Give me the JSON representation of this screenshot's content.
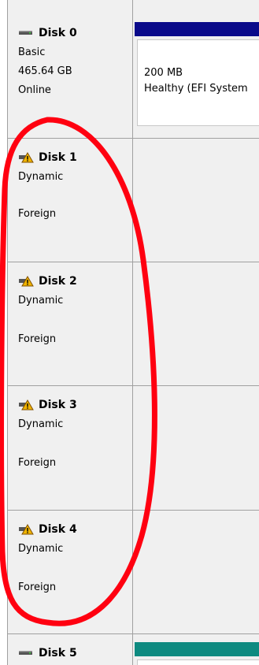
{
  "disks": [
    {
      "name": "Disk 0",
      "type": "Basic",
      "size": "465.64 GB",
      "status": "Online",
      "icon": "disk-icon",
      "volume": {
        "size": "200 MB",
        "status": "Healthy (EFI System"
      }
    },
    {
      "name": "Disk 1",
      "type": "Dynamic",
      "status": "Foreign",
      "icon": "foreign-disk-warning-icon"
    },
    {
      "name": "Disk 2",
      "type": "Dynamic",
      "status": "Foreign",
      "icon": "foreign-disk-warning-icon"
    },
    {
      "name": "Disk 3",
      "type": "Dynamic",
      "status": "Foreign",
      "icon": "foreign-disk-warning-icon"
    },
    {
      "name": "Disk 4",
      "type": "Dynamic",
      "status": "Foreign",
      "icon": "foreign-disk-warning-icon"
    },
    {
      "name": "Disk 5",
      "icon": "disk-icon"
    }
  ],
  "colors": {
    "primary_partition_bar": "#0a0a8a",
    "disk5_partition_bar": "#0e8a80",
    "annotation_oval": "#ff0010",
    "warning_icon": "#f0b400"
  }
}
